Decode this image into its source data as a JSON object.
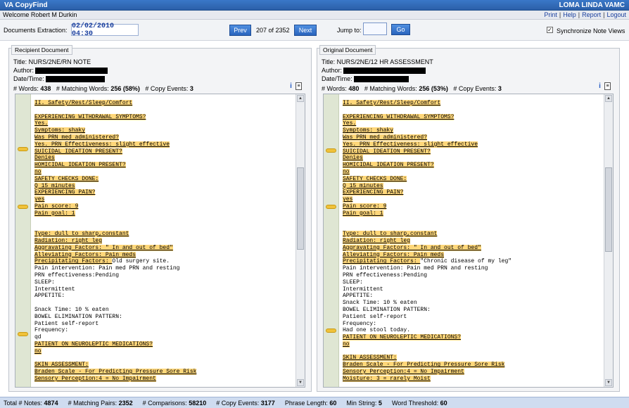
{
  "app": {
    "title": "VA CopyFind",
    "facility": "LOMA LINDA VAMC"
  },
  "welcome": {
    "text": "Welcome Robert M Durkin"
  },
  "links": [
    "Print",
    "Help",
    "Report",
    "Logout"
  ],
  "toolbar": {
    "extraction_label": "Documents Extraction:",
    "extraction_date": "02/02/2010 04:30",
    "prev_label": "Prev",
    "position": "207 of 2352",
    "next_label": "Next",
    "jump_label": "Jump to:",
    "go_label": "Go",
    "sync_label": "Synchronize Note Views",
    "sync_checked": true
  },
  "recipient": {
    "legend": "Recipient Document",
    "title_line": "Title: NURS/2NE/RN NOTE",
    "author_label": "Author:",
    "datetime_label": "Date/Time:",
    "words_label": "# Words:",
    "words": "438",
    "matching_label": "# Matching Words:",
    "matching": "256 (58%)",
    "copy_label": "# Copy Events:",
    "copy": "3",
    "lines": [
      {
        "t": "II. Safety/Rest/Sleep/Comfort",
        "h": true
      },
      {
        "t": "",
        "h": false
      },
      {
        "t": "EXPERIENCING WITHDRAWAL SYMPTOMS?",
        "h": true
      },
      {
        "t": "Yes.",
        "h": true
      },
      {
        "t": "Symptoms: shaky",
        "h": true
      },
      {
        "t": "Was PRN med administered?",
        "h": true
      },
      {
        "t": "Yes. PRN Effectiveness: slight effective",
        "h": true
      },
      {
        "t": "SUICIDAL IDEATION PRESENT?",
        "h": true
      },
      {
        "t": "Denies",
        "h": true
      },
      {
        "t": "HOMICIDAL IDEATION PRESENT?",
        "h": true
      },
      {
        "t": "no",
        "h": true
      },
      {
        "t": "SAFETY CHECKS DONE:",
        "h": true
      },
      {
        "t": "Q 15 minutes",
        "h": true
      },
      {
        "t": "EXPERIENCING PAIN?",
        "h": true
      },
      {
        "t": "yes",
        "h": true
      },
      {
        "t": "Pain score: 9",
        "h": true
      },
      {
        "t": "Pain goal: 1",
        "h": true
      },
      {
        "t": "",
        "h": false
      },
      {
        "t": "",
        "h": false
      },
      {
        "t": "Type: dull to sharp,constant",
        "h": true
      },
      {
        "t": "Radiation: right leg",
        "h": true
      },
      {
        "t": "Aggravating Factors: \" In and out of bed\"",
        "h": true
      },
      {
        "t": "Alleviating Factors: Pain meds",
        "h": true
      },
      {
        "t": "Precipitating Factors: ",
        "h": true,
        "rest": "Old surgery site."
      },
      {
        "t": "Pain intervention: Pain med PRN and resting",
        "h": false
      },
      {
        "t": "PRN effectiveness:Pending",
        "h": false
      },
      {
        "t": "SLEEP:",
        "h": false
      },
      {
        "t": "Intermittent",
        "h": false
      },
      {
        "t": "APPETITE:",
        "h": false
      },
      {
        "t": "",
        "h": false
      },
      {
        "t": "Snack Time: 10 % eaten",
        "h": false
      },
      {
        "t": "BOWEL ELIMINATION PATTERN:",
        "h": false
      },
      {
        "t": "Patient self-report",
        "h": false
      },
      {
        "t": "Frequency:",
        "h": false
      },
      {
        "t": "qd",
        "h": false
      },
      {
        "t": "PATIENT ON NEUROLEPTIC MEDICATIONS?",
        "h": true
      },
      {
        "t": "no",
        "h": true
      },
      {
        "t": "",
        "h": false
      },
      {
        "t": "SKIN ASSESSMENT:",
        "h": true
      },
      {
        "t": "Braden Scale - For Predicting Pressure Sore Risk",
        "h": true
      },
      {
        "t": "Sensory Perception:4 = No Impairment",
        "h": true
      }
    ]
  },
  "original": {
    "legend": "Original Document",
    "title_line": "Title: NURS/2NE/12 HR ASSESSMENT",
    "author_label": "Author:",
    "datetime_label": "Date/Time:",
    "words_label": "# Words:",
    "words": "480",
    "matching_label": "# Matching Words:",
    "matching": "256 (53%)",
    "copy_label": "# Copy Events:",
    "copy": "3",
    "lines": [
      {
        "t": "II. Safety/Rest/Sleep/Comfort",
        "h": true
      },
      {
        "t": "",
        "h": false
      },
      {
        "t": "EXPERIENCING WITHDRAWAL SYMPTOMS?",
        "h": true
      },
      {
        "t": "Yes.",
        "h": true
      },
      {
        "t": "Symptoms: shaky",
        "h": true
      },
      {
        "t": "Was PRN med administered?",
        "h": true
      },
      {
        "t": "Yes. PRN Effectiveness: slight effective",
        "h": true
      },
      {
        "t": "SUICIDAL IDEATION PRESENT?",
        "h": true
      },
      {
        "t": "Denies",
        "h": true
      },
      {
        "t": "HOMICIDAL IDEATION PRESENT?",
        "h": true
      },
      {
        "t": "no",
        "h": true
      },
      {
        "t": "SAFETY CHECKS DONE:",
        "h": true
      },
      {
        "t": "Q 15 minutes",
        "h": true
      },
      {
        "t": "EXPERIENCING PAIN?",
        "h": true
      },
      {
        "t": "yes",
        "h": true
      },
      {
        "t": "Pain score: 9",
        "h": true
      },
      {
        "t": "Pain goal: 1",
        "h": true
      },
      {
        "t": "",
        "h": false
      },
      {
        "t": "",
        "h": false
      },
      {
        "t": "Type: dull to sharp,constant",
        "h": true
      },
      {
        "t": "Radiation: right leg",
        "h": true
      },
      {
        "t": "Aggravating Factors: \" In and out of bed\"",
        "h": true
      },
      {
        "t": "Alleviating Factors: Pain meds",
        "h": true
      },
      {
        "t": "Precipitating Factors: ",
        "h": true,
        "rest": "\"Chronic disease of my leg\""
      },
      {
        "t": "Pain intervention: Pain med PRN and resting",
        "h": false
      },
      {
        "t": "PRN effectiveness:Pending",
        "h": false
      },
      {
        "t": "SLEEP:",
        "h": false
      },
      {
        "t": "Intermittent",
        "h": false
      },
      {
        "t": "APPETITE:",
        "h": false
      },
      {
        "t": "Snack Time: 10 % eaten",
        "h": false
      },
      {
        "t": "BOWEL ELIMINATION PATTERN:",
        "h": false
      },
      {
        "t": "Patient self-report",
        "h": false
      },
      {
        "t": "Frequency:",
        "h": false
      },
      {
        "t": "Had one stool today.",
        "h": false
      },
      {
        "t": "PATIENT ON NEUROLEPTIC MEDICATIONS?",
        "h": true
      },
      {
        "t": "no",
        "h": true
      },
      {
        "t": "",
        "h": false
      },
      {
        "t": "SKIN ASSESSMENT:",
        "h": true
      },
      {
        "t": "Braden Scale - For Predicting Pressure Sore Risk",
        "h": true
      },
      {
        "t": "Sensory Perception:4 = No Impairment",
        "h": true
      },
      {
        "t": "Moisture: 3 = rarely Moist",
        "h": true
      }
    ]
  },
  "status": {
    "notes_label": "Total # Notes:",
    "notes": "4874",
    "pairs_label": "# Matching Pairs:",
    "pairs": "2352",
    "comparisons_label": "# Comparisons:",
    "comparisons": "58210",
    "copy_label": "# Copy Events:",
    "copy": "3177",
    "phrase_label": "Phrase Length:",
    "phrase": "60",
    "minstring_label": "Min String:",
    "minstring": "5",
    "threshold_label": "Word Threshold:",
    "threshold": "60"
  },
  "colors": {
    "highlight": "#ffd77a",
    "marker": "#f0c23a",
    "titlebar": "#2c5fa8"
  }
}
